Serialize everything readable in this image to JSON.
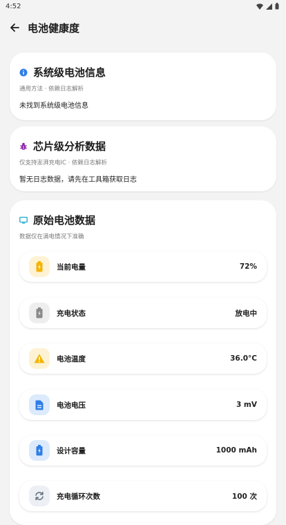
{
  "status_bar": {
    "time": "4:52"
  },
  "app_bar": {
    "title": "电池健康度"
  },
  "cards": [
    {
      "title": "系统级电池信息",
      "subtitle": "通用方法 · 依赖日志解析",
      "message": "未找到系统级电池信息",
      "icon": "info-icon",
      "accent": "#2f7ee6"
    },
    {
      "title": "芯片级分析数据",
      "subtitle": "仅支持澎湃充电IC · 依赖日志解析",
      "message": "暂无日志数据，请先在工具箱获取日志",
      "icon": "bug-icon",
      "accent": "#8e24aa"
    },
    {
      "title": "原始电池数据",
      "subtitle": "数据仅在满电情况下准确",
      "icon": "monitor-icon",
      "accent": "#1aa8c9"
    }
  ],
  "battery_rows": [
    {
      "label": "当前电量",
      "value": "72%",
      "icon": "battery-charging-icon",
      "icon_bg": "#fdf2d3",
      "icon_color": "#f4b400"
    },
    {
      "label": "充电状态",
      "value": "放电中",
      "icon": "battery-icon",
      "icon_bg": "#eeeeee",
      "icon_color": "#8a8a8a"
    },
    {
      "label": "电池温度",
      "value": "36.0°C",
      "icon": "warning-icon",
      "icon_bg": "#fdf2d3",
      "icon_color": "#f4b400"
    },
    {
      "label": "电池电压",
      "value": "3 mV",
      "icon": "document-icon",
      "icon_bg": "#dceafb",
      "icon_color": "#2f7ee6"
    },
    {
      "label": "设计容量",
      "value": "1000 mAh",
      "icon": "battery-charging-icon",
      "icon_bg": "#dceafb",
      "icon_color": "#2f7ee6"
    },
    {
      "label": "充电循环次数",
      "value": "100 次",
      "icon": "sync-icon",
      "icon_bg": "#eceff3",
      "icon_color": "#5f6b7a"
    }
  ]
}
